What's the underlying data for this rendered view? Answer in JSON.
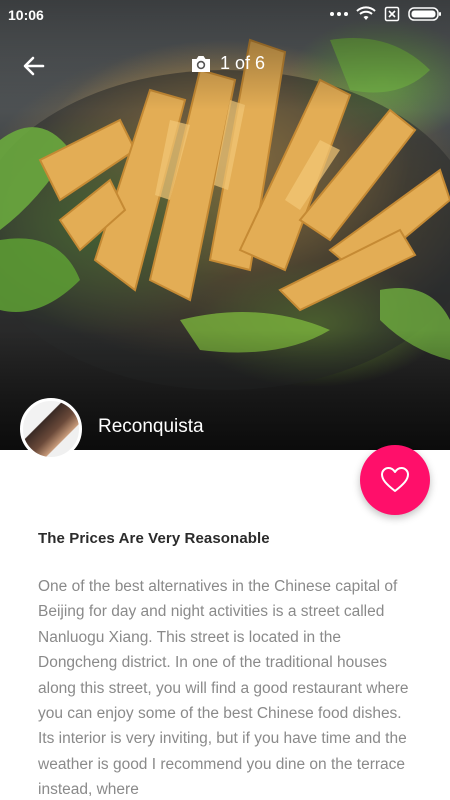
{
  "status_bar": {
    "time": "10:06",
    "icons": [
      "more-dots-icon",
      "wifi-icon",
      "no-sim-icon",
      "battery-icon"
    ]
  },
  "top_bar": {
    "back_icon": "arrow-left-icon",
    "camera_icon": "camera-icon",
    "photo_counter": "1 of 6"
  },
  "author": {
    "name": "Reconquista"
  },
  "favorite": {
    "icon": "heart-icon",
    "color": "#ff0f6a"
  },
  "article": {
    "title": "The Prices Are Very Reasonable",
    "body": "One of the best alternatives in the Chinese capital of Beijing for day and night activities is a street called Nanluogu Xiang. This street is located in the Dongcheng district. In one of the traditional houses along this street, you will find a good restaurant where you can enjoy some of the best Chinese food dishes. Its interior is very inviting, but if you have time and the weather is good I recommend you dine on the terrace instead, where"
  }
}
